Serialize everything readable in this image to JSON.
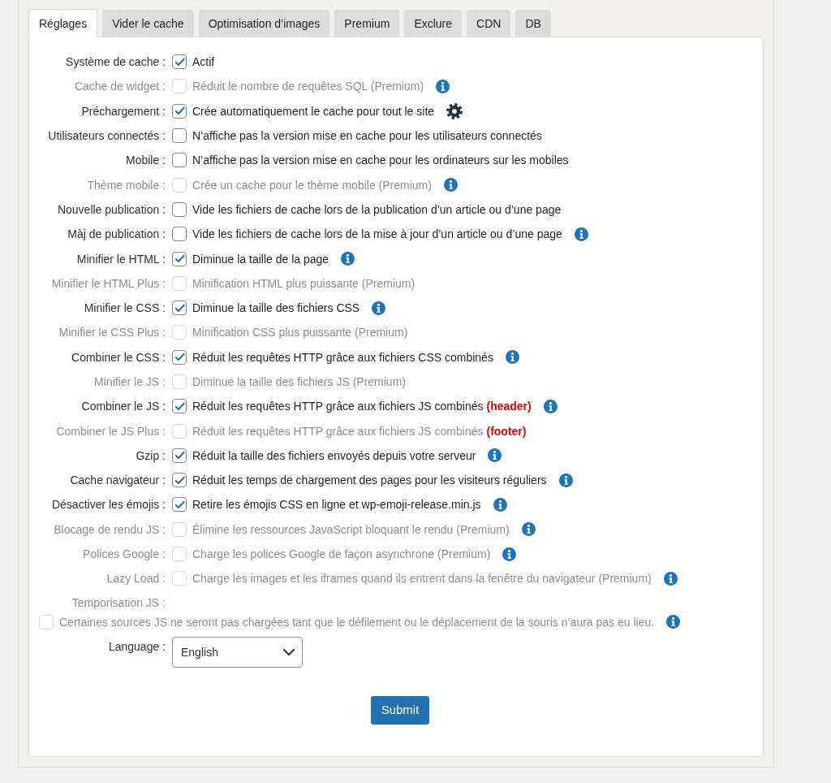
{
  "tabs": [
    {
      "label": "Réglages",
      "selected": true
    },
    {
      "label": "Vider le cache",
      "selected": false
    },
    {
      "label": "Optimisation d’images",
      "selected": false
    },
    {
      "label": "Premium",
      "selected": false
    },
    {
      "label": "Exclure",
      "selected": false
    },
    {
      "label": "CDN",
      "selected": false
    },
    {
      "label": "DB",
      "selected": false
    }
  ],
  "settings": [
    {
      "kind": "checkbox",
      "label": "Système de cache :",
      "checked": true,
      "disabled": false,
      "description": "Actif"
    },
    {
      "kind": "checkbox_info",
      "label": "Cache de widget :",
      "checked": false,
      "disabled": true,
      "description": "Réduit le nombre de requêtes SQL (Premium)"
    },
    {
      "kind": "checkbox_gear",
      "label": "Préchargement :",
      "checked": true,
      "disabled": false,
      "description": "Crée automatiquement le cache pour tout le site"
    },
    {
      "kind": "checkbox",
      "label": "Utilisateurs connectés :",
      "checked": false,
      "disabled": false,
      "description": "N’affiche pas la version mise en cache pour les utilisateurs connectés"
    },
    {
      "kind": "checkbox",
      "label": "Mobile :",
      "checked": false,
      "disabled": false,
      "description": "N’affiche pas la version mise en cache pour les ordinateurs sur les mobiles"
    },
    {
      "kind": "checkbox_info",
      "label": "Thème mobile :",
      "checked": false,
      "disabled": true,
      "description": "Crée un cache pour le thème mobile (Premium)"
    },
    {
      "kind": "checkbox",
      "label": "Nouvelle publication :",
      "checked": false,
      "disabled": false,
      "description": "Vide les fichiers de cache lors de la publication d’un article ou d’une page"
    },
    {
      "kind": "checkbox_info",
      "label": "Màj de publication :",
      "checked": false,
      "disabled": false,
      "description": "Vide les fichiers de cache lors de la mise à jour d’un article ou d’une page"
    },
    {
      "kind": "checkbox_info",
      "label": "Minifier le HTML :",
      "checked": true,
      "disabled": false,
      "description": "Diminue la taille de la page"
    },
    {
      "kind": "checkbox",
      "label": "Minifier le HTML Plus :",
      "checked": false,
      "disabled": true,
      "description": "Minification HTML plus puissante (Premium)"
    },
    {
      "kind": "checkbox_info",
      "label": "Minifier le CSS :",
      "checked": true,
      "disabled": false,
      "description": "Diminue la taille des fichiers CSS"
    },
    {
      "kind": "checkbox",
      "label": "Minifier le CSS Plus :",
      "checked": false,
      "disabled": true,
      "description": "Minification CSS plus puissante (Premium)"
    },
    {
      "kind": "checkbox_info",
      "label": "Combiner le CSS :",
      "checked": true,
      "disabled": false,
      "description": "Réduit les requêtes HTTP grâce aux fichiers CSS combinés"
    },
    {
      "kind": "checkbox",
      "label": "Minifier le JS :",
      "checked": false,
      "disabled": true,
      "description": "Diminue la taille des fichiers JS (Premium)"
    },
    {
      "kind": "checkbox_info",
      "label": "Combiner le JS :",
      "checked": true,
      "disabled": false,
      "description": "Réduit les requêtes HTTP grâce aux fichiers JS combinés",
      "note": "(header)"
    },
    {
      "kind": "checkbox",
      "label": "Combiner le JS Plus :",
      "checked": false,
      "disabled": true,
      "description": "Réduit les requêtes HTTP grâce aux fichiers JS combinés",
      "note": "(footer)"
    },
    {
      "kind": "checkbox_info",
      "label": "Gzip :",
      "checked": true,
      "disabled": false,
      "description": "Réduit la taille des fichiers envoyés depuis votre serveur"
    },
    {
      "kind": "checkbox_info",
      "label": "Cache navigateur :",
      "checked": true,
      "disabled": false,
      "description": "Réduit les temps de chargement des pages pour les visiteurs réguliers"
    },
    {
      "kind": "checkbox_info",
      "label": "Désactiver les émojis :",
      "checked": true,
      "disabled": false,
      "description": "Retire les émojis CSS en ligne et wp-emoji-release.min.js"
    },
    {
      "kind": "checkbox_info",
      "label": "Blocage de rendu JS :",
      "checked": false,
      "disabled": true,
      "description": "Élimine les ressources JavaScript bloquant le rendu (Premium)"
    },
    {
      "kind": "checkbox_info",
      "label": "Polices Google :",
      "checked": false,
      "disabled": true,
      "description": "Charge les polices Google de façon asynchrone (Premium)"
    },
    {
      "kind": "checkbox_info",
      "label": "Lazy Load :",
      "checked": false,
      "disabled": true,
      "description": "Charge les images et les iframes quand ils entrent dans la fenêtre du navigateur (Premium)"
    },
    {
      "kind": "checkbox_below_info",
      "label": "Temporisation JS :",
      "checked": false,
      "disabled": true,
      "description": "Certaines sources JS ne seront pas chargées tant que le défilement ou le déplacement de la souris n’aura pas eu lieu."
    },
    {
      "kind": "select",
      "label": "Language :",
      "value": "English"
    }
  ],
  "submit": {
    "label": "Submit"
  }
}
